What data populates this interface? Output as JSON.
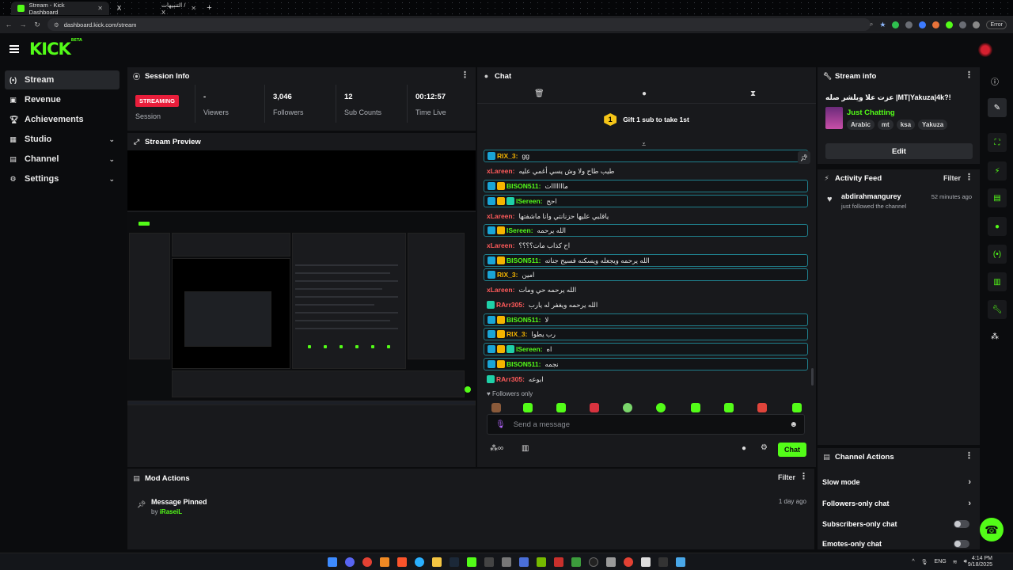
{
  "browser": {
    "tabs": [
      {
        "title": "Stream - Kick Dashboard"
      },
      {
        "title": ""
      },
      {
        "title": "التنبيهات / X"
      }
    ],
    "url": "dashboard.kick.com/stream",
    "error_label": "Error"
  },
  "app": {
    "logo": "KICK",
    "logo_badge": "BETA"
  },
  "sidebar": {
    "items": [
      {
        "label": "Stream",
        "icon": "stream-icon",
        "active": true
      },
      {
        "label": "Revenue",
        "icon": "revenue-icon"
      },
      {
        "label": "Achievements",
        "icon": "trophy-icon"
      },
      {
        "label": "Studio",
        "icon": "studio-icon",
        "expandable": true
      },
      {
        "label": "Channel",
        "icon": "channel-icon",
        "expandable": true
      },
      {
        "label": "Settings",
        "icon": "gear-icon",
        "expandable": true
      }
    ]
  },
  "session": {
    "title": "Session Info",
    "status": "STREAMING",
    "stats": [
      {
        "value": "",
        "label": "Session"
      },
      {
        "value": "-",
        "label": "Viewers"
      },
      {
        "value": "3,046",
        "label": "Followers"
      },
      {
        "value": "12",
        "label": "Sub Counts"
      },
      {
        "value": "00:12:57",
        "label": "Time Live"
      }
    ]
  },
  "preview": {
    "title": "Stream Preview"
  },
  "chat": {
    "title": "Chat",
    "gift_count": "1",
    "gift_text": "Gift 1 sub to take 1st",
    "messages": [
      {
        "user": "RIX_3:",
        "text": "gg",
        "color": "#f5b400",
        "badges": [
          "mod"
        ],
        "boxed": true
      },
      {
        "user": "xLareen:",
        "text": "طيب طاح ولا وش يسي أغمي عليه",
        "color": "#ff5a5a",
        "badges": [],
        "boxed": false
      },
      {
        "user": "BISON511:",
        "text": "مااااااات",
        "color": "#53fc18",
        "badges": [
          "mod",
          "vip"
        ],
        "boxed": true
      },
      {
        "user": "lSereen:",
        "text": "احح",
        "color": "#53fc18",
        "badges": [
          "mod",
          "vip",
          "sub"
        ],
        "boxed": true
      },
      {
        "user": "xLareen:",
        "text": "ياقلبي عليها حزنانتي وانا ماشفتها",
        "color": "#ff5a5a",
        "badges": [],
        "boxed": false
      },
      {
        "user": "lSereen:",
        "text": "الله يرحمه",
        "color": "#53fc18",
        "badges": [
          "mod",
          "vip"
        ],
        "boxed": true
      },
      {
        "user": "xLareen:",
        "text": "اح كذاب مات؟؟؟؟",
        "color": "#ff5a5a",
        "badges": [],
        "boxed": false
      },
      {
        "user": "BISON511:",
        "text": "الله يرحمه ويجعله ويسكنه فسيح جناته",
        "color": "#53fc18",
        "badges": [
          "mod",
          "vip"
        ],
        "boxed": true
      },
      {
        "user": "RIX_3:",
        "text": "امين",
        "color": "#f5b400",
        "badges": [
          "mod"
        ],
        "boxed": true
      },
      {
        "user": "xLareen:",
        "text": "الله يرحمه حي ومات",
        "color": "#ff5a5a",
        "badges": [],
        "boxed": false
      },
      {
        "user": "RArr305:",
        "text": "الله يرحمه ويغفر له يارب",
        "color": "#ff5a5a",
        "badges": [
          "sub"
        ],
        "boxed": false
      },
      {
        "user": "BISON511:",
        "text": "لا",
        "color": "#53fc18",
        "badges": [
          "mod",
          "vip"
        ],
        "boxed": true
      },
      {
        "user": "RIX_3:",
        "text": "رب يطوا",
        "color": "#f5b400",
        "badges": [
          "mod",
          "vip"
        ],
        "boxed": true
      },
      {
        "user": "lSereen:",
        "text": "اه",
        "color": "#53fc18",
        "badges": [
          "mod",
          "vip",
          "sub"
        ],
        "boxed": true
      },
      {
        "user": "BISON511:",
        "text": "نجمه",
        "color": "#53fc18",
        "badges": [
          "mod",
          "vip"
        ],
        "boxed": true
      },
      {
        "user": "RArr305:",
        "text": "ابوعه",
        "color": "#ff5a5a",
        "badges": [
          "sub"
        ],
        "boxed": false
      }
    ],
    "followers_only": "Followers only",
    "send_placeholder": "Send a message",
    "send_button": "Chat"
  },
  "stream_info": {
    "title": "Stream info",
    "stream_title": "عزت علا ويلشر صله |MT|Yakuza|4k?!",
    "category": "Just Chatting",
    "tags": [
      "Arabic",
      "mt",
      "ksa",
      "Yakuza"
    ],
    "edit": "Edit"
  },
  "activity": {
    "title": "Activity Feed",
    "filter": "Filter",
    "items": [
      {
        "name": "abdirahmangurey",
        "desc": "just followed the channel",
        "time": "52 minutes ago"
      }
    ]
  },
  "channel_actions": {
    "title": "Channel Actions",
    "rows": [
      {
        "label": "Slow mode",
        "kind": "arrow"
      },
      {
        "label": "Followers-only chat",
        "kind": "arrow"
      },
      {
        "label": "Subscribers-only chat",
        "kind": "toggle",
        "on": false
      },
      {
        "label": "Emotes-only chat",
        "kind": "toggle",
        "on": false
      }
    ]
  },
  "mod_actions": {
    "title": "Mod Actions",
    "filter": "Filter",
    "items": [
      {
        "title": "Message Pinned",
        "by_prefix": "by",
        "by_user": "iRaseiL",
        "time": "1 day ago"
      }
    ]
  },
  "taskbar": {
    "lang": "ENG",
    "time": "4:14 PM",
    "date": "9/18/2025"
  },
  "colors": {
    "brand": "#53fc18",
    "streaming": "#e91e3b",
    "panel": "#18191c",
    "bg": "#0b0c0e"
  }
}
